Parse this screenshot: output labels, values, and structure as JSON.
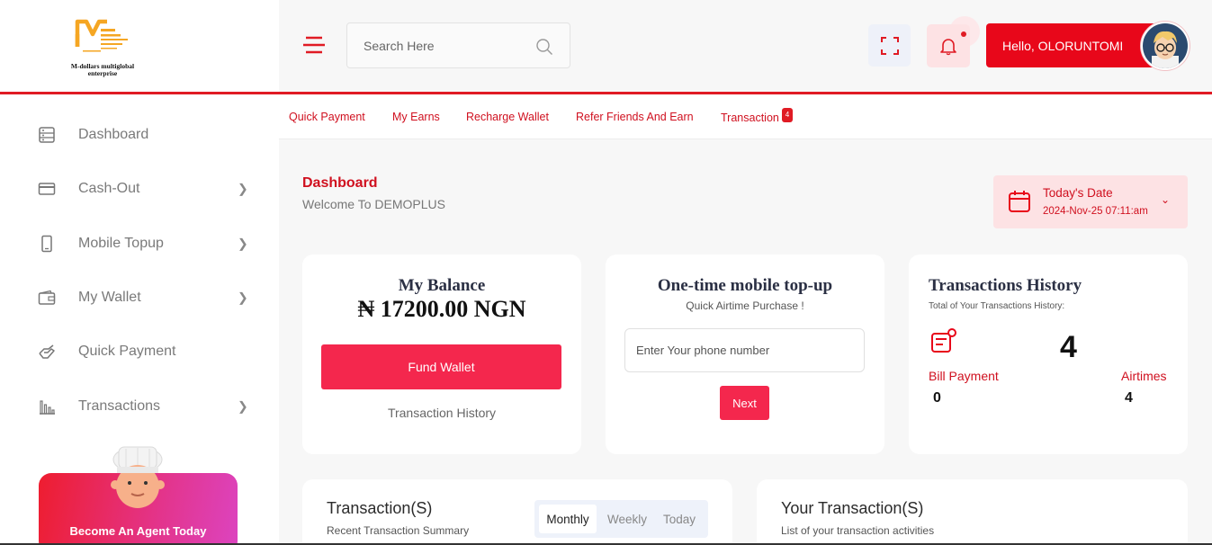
{
  "brand": {
    "name": "M-dollars multiglobal enterprise",
    "line1": "M-dollars multiglobal",
    "line2": "enterprise",
    "accent": "#e01b24",
    "logo_orange": "#f5a623"
  },
  "header": {
    "search_placeholder": "Search Here",
    "user_greeting": "Hello, OLORUNTOMI"
  },
  "sidebar": {
    "items": [
      {
        "label": "Dashboard",
        "icon": "dashboard-icon"
      },
      {
        "label": "Cash-Out",
        "icon": "credit-card-icon"
      },
      {
        "label": "Mobile Topup",
        "icon": "mobile-phone-icon"
      },
      {
        "label": "My Wallet",
        "icon": "wallet-icon"
      },
      {
        "label": "Quick Payment",
        "icon": "hand-payment-icon"
      },
      {
        "label": "Transactions",
        "icon": "bar-chart-icon"
      }
    ],
    "agent_cta": "Become An Agent Today"
  },
  "subnav": {
    "links": [
      "Quick Payment",
      "My Earns",
      "Recharge Wallet",
      "Refer Friends And Earn",
      "Transaction"
    ],
    "badge": "4"
  },
  "page": {
    "title": "Dashboard",
    "subtitle": "Welcome To DEMOPLUS",
    "date_label": "Today's Date",
    "date_value": "2024-Nov-25 07:11:am"
  },
  "balance": {
    "title": "My Balance",
    "amount": "₦ 17200.00 NGN",
    "fund_button": "Fund Wallet",
    "history_link": "Transaction History"
  },
  "topup": {
    "title": "One-time mobile top-up",
    "subtitle": "Quick Airtime Purchase !",
    "phone_placeholder": "Enter Your phone number",
    "next_button": "Next"
  },
  "history": {
    "title": "Transactions History",
    "subtitle": "Total of Your Transactions History:",
    "count": "4",
    "bill_label": "Bill Payment",
    "bill_value": "0",
    "airtime_label": "Airtimes",
    "airtime_value": "4"
  },
  "transactions_panel": {
    "title": "Transaction(S)",
    "subtitle": "Recent Transaction Summary",
    "tabs": [
      "Monthly",
      "Weekly",
      "Today"
    ]
  },
  "your_transactions": {
    "title": "Your Transaction(S)",
    "subtitle": "List of your transaction activities"
  }
}
